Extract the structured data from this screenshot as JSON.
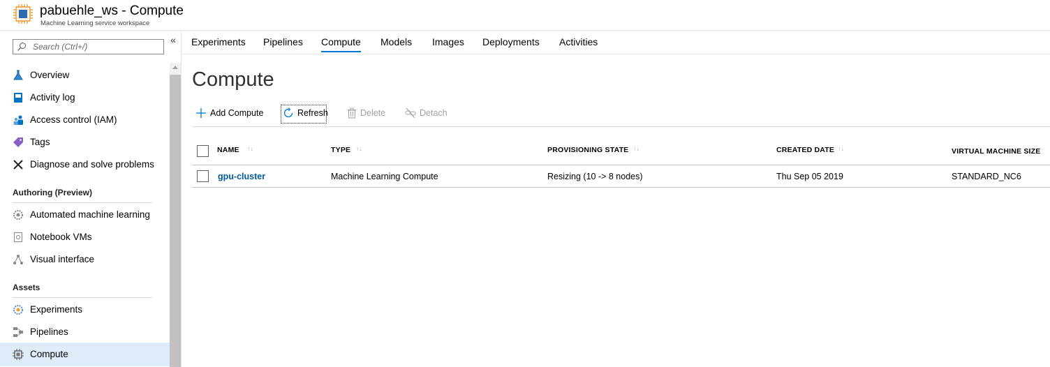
{
  "header": {
    "title": "pabuehle_ws - Compute",
    "subtitle": "Machine Learning service workspace",
    "icon": "compute-chip-icon"
  },
  "sidebar": {
    "search_placeholder": "Search (Ctrl+/)",
    "collapse_label": "«",
    "items": [
      {
        "label": "Overview",
        "icon": "flask-icon"
      },
      {
        "label": "Activity log",
        "icon": "log-book-icon"
      },
      {
        "label": "Access control (IAM)",
        "icon": "people-icon"
      },
      {
        "label": "Tags",
        "icon": "tag-icon"
      },
      {
        "label": "Diagnose and solve problems",
        "icon": "wrench-icon"
      }
    ],
    "sections": [
      {
        "heading": "Authoring (Preview)",
        "items": [
          {
            "label": "Automated machine learning",
            "icon": "gear-icon"
          },
          {
            "label": "Notebook VMs",
            "icon": "notebook-icon"
          },
          {
            "label": "Visual interface",
            "icon": "network-icon"
          }
        ]
      },
      {
        "heading": "Assets",
        "items": [
          {
            "label": "Experiments",
            "icon": "experiments-icon"
          },
          {
            "label": "Pipelines",
            "icon": "pipeline-icon"
          },
          {
            "label": "Compute",
            "icon": "chip-icon",
            "active": true
          }
        ]
      }
    ]
  },
  "tabs": [
    "Experiments",
    "Pipelines",
    "Compute",
    "Models",
    "Images",
    "Deployments",
    "Activities"
  ],
  "active_tab": "Compute",
  "page_title": "Compute",
  "toolbar": {
    "add": "Add Compute",
    "refresh": "Refresh",
    "delete": "Delete",
    "detach": "Detach"
  },
  "table": {
    "columns": [
      "NAME",
      "TYPE",
      "PROVISIONING STATE",
      "CREATED DATE",
      "VIRTUAL MACHINE SIZE"
    ],
    "rows": [
      [
        "gpu-cluster",
        "Machine Learning Compute",
        "Resizing (10 -> 8 nodes)",
        "Thu Sep 05 2019",
        "STANDARD_NC6"
      ]
    ]
  },
  "colors": {
    "accent": "#0078d4",
    "link": "#005a9e",
    "active_nav_bg": "#deecf9"
  }
}
